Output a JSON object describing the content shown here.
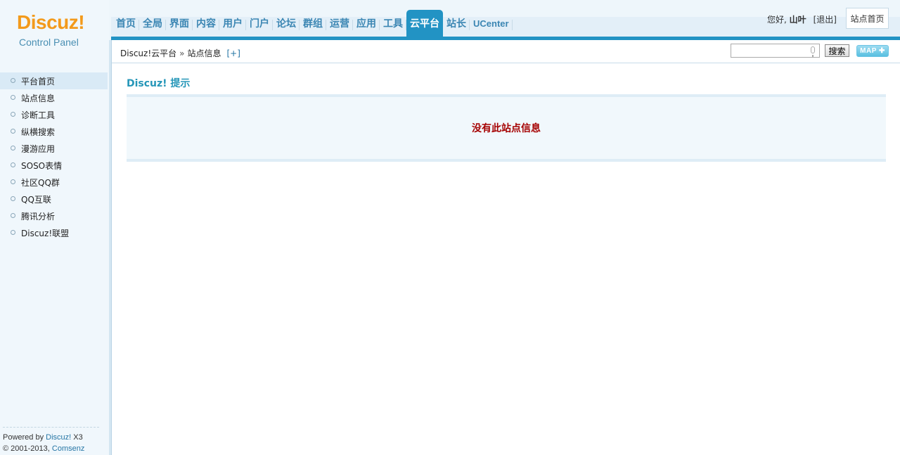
{
  "logo": {
    "brand": "Discuz!",
    "subtitle": "Control Panel"
  },
  "nav": {
    "items": [
      {
        "label": "首页",
        "active": false
      },
      {
        "label": "全局",
        "active": false
      },
      {
        "label": "界面",
        "active": false
      },
      {
        "label": "内容",
        "active": false
      },
      {
        "label": "用户",
        "active": false
      },
      {
        "label": "门户",
        "active": false
      },
      {
        "label": "论坛",
        "active": false
      },
      {
        "label": "群组",
        "active": false
      },
      {
        "label": "运营",
        "active": false
      },
      {
        "label": "应用",
        "active": false
      },
      {
        "label": "工具",
        "active": false
      },
      {
        "label": "云平台",
        "active": true
      },
      {
        "label": "站长",
        "active": false
      },
      {
        "label": "UCenter",
        "active": false
      }
    ]
  },
  "user": {
    "greeting": "您好,",
    "name": "山叶",
    "logout": "[退出]",
    "site_home": "站点首页"
  },
  "breadcrumb": {
    "root": "Discuz!云平台",
    "separator": "»",
    "current": "站点信息",
    "add": "[+]"
  },
  "search": {
    "placeholder": "",
    "button": "搜索",
    "map_button": "MAP ✚"
  },
  "sidebar": {
    "items": [
      {
        "label": "平台首页",
        "active": true
      },
      {
        "label": "站点信息",
        "active": false
      },
      {
        "label": "诊断工具",
        "active": false
      },
      {
        "label": "纵横搜索",
        "active": false
      },
      {
        "label": "漫游应用",
        "active": false
      },
      {
        "label": "SOSO表情",
        "active": false
      },
      {
        "label": "社区QQ群",
        "active": false
      },
      {
        "label": "QQ互联",
        "active": false
      },
      {
        "label": "腾讯分析",
        "active": false
      },
      {
        "label": "Discuz!联盟",
        "active": false
      }
    ],
    "footer": {
      "powered_prefix": "Powered by",
      "powered_link": "Discuz!",
      "version": "X3",
      "copyright_prefix": "© 2001-2013,",
      "company": "Comsenz Inc."
    }
  },
  "main": {
    "title": "Discuz! 提示",
    "message": "没有此站点信息"
  },
  "colors": {
    "accent": "#2293c4",
    "title": "#2596b8",
    "error": "#a50000",
    "logo": "#f39a1b"
  }
}
